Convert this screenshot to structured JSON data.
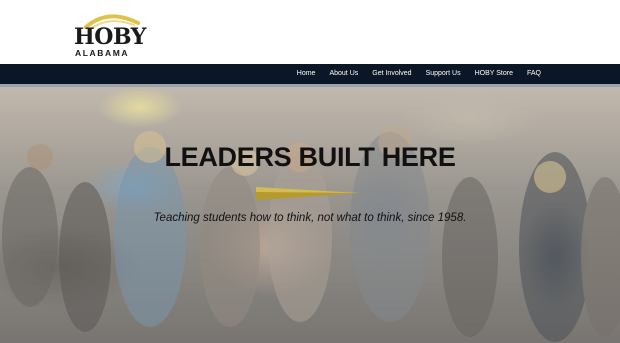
{
  "header": {
    "logo": {
      "main": "HOBY",
      "sub": "ALABAMA"
    }
  },
  "nav": {
    "items": [
      {
        "label": "Home"
      },
      {
        "label": "About Us"
      },
      {
        "label": "Get Involved"
      },
      {
        "label": "Support Us"
      },
      {
        "label": "HOBY Store"
      },
      {
        "label": "FAQ"
      }
    ]
  },
  "hero": {
    "title": "LEADERS BUILT HERE",
    "subtitle": "Teaching students how to think, not what to think, since 1958.",
    "accent_color": "#b59a2c"
  },
  "colors": {
    "nav_background": "#0b1626",
    "logo_arc": "#e2c14a"
  }
}
